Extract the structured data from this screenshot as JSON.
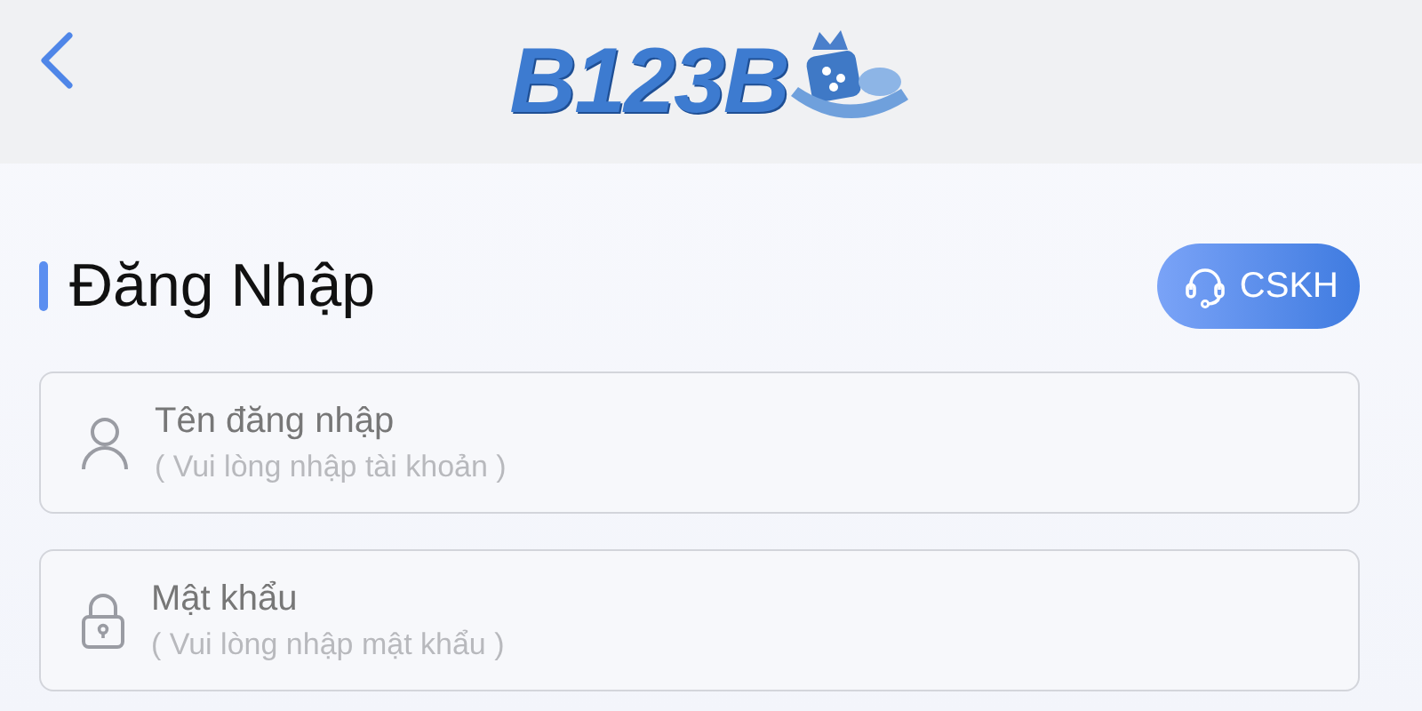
{
  "header": {
    "logo": "B123B"
  },
  "title": "Đăng Nhập",
  "support_button": "CSKH",
  "fields": [
    {
      "kind": "user",
      "label": "Tên đăng nhập",
      "placeholder": "( Vui lòng nhập tài khoản )"
    },
    {
      "kind": "password",
      "label": "Mật khẩu",
      "placeholder": "( Vui lòng nhập mật khẩu )"
    }
  ]
}
